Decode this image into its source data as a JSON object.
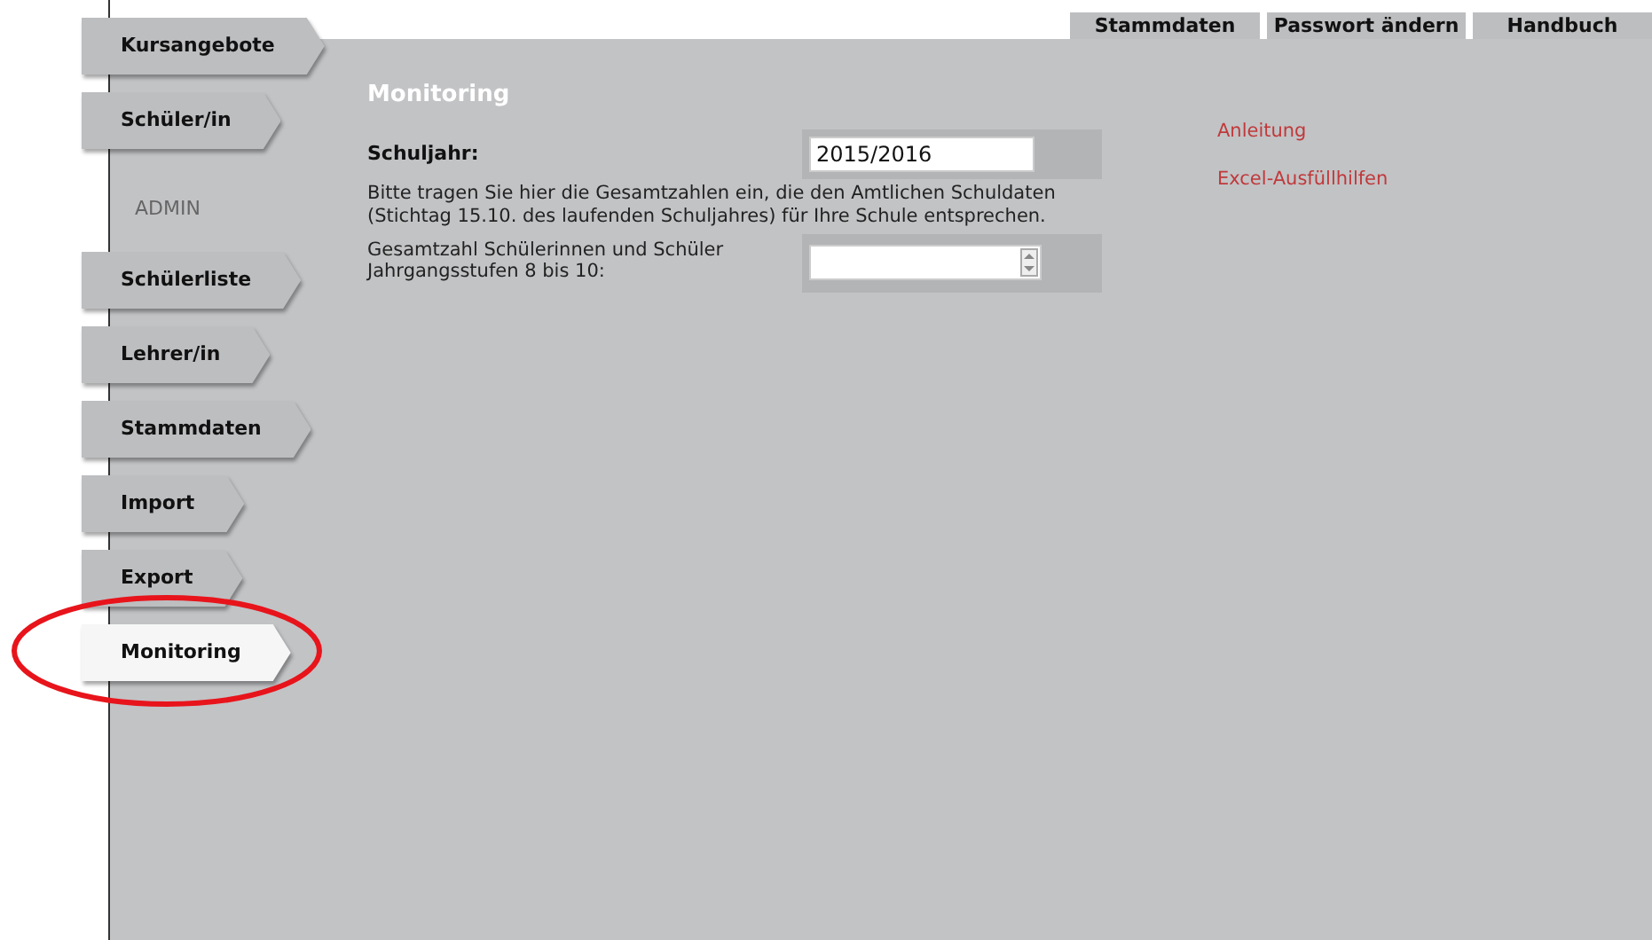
{
  "top_tabs": [
    {
      "label": "Stammdaten"
    },
    {
      "label": "Passwort ändern"
    },
    {
      "label": "Handbuch"
    }
  ],
  "sidebar": {
    "items": [
      {
        "kind": "tab",
        "label": "Kursangebote",
        "selected": false
      },
      {
        "kind": "tab",
        "label": "Schüler/in",
        "selected": false
      },
      {
        "kind": "heading",
        "label": "ADMIN"
      },
      {
        "kind": "tab",
        "label": "Schülerliste",
        "selected": false
      },
      {
        "kind": "tab",
        "label": "Lehrer/in",
        "selected": false
      },
      {
        "kind": "tab",
        "label": "Stammdaten",
        "selected": false
      },
      {
        "kind": "tab",
        "label": "Import",
        "selected": false
      },
      {
        "kind": "tab",
        "label": "Export",
        "selected": false
      },
      {
        "kind": "tab",
        "label": "Monitoring",
        "selected": true
      }
    ]
  },
  "page_title": "Monitoring",
  "school_year": {
    "label": "Schuljahr:",
    "value": "2015/2016"
  },
  "instructions": "Bitte tragen Sie hier die Gesamtzahlen ein, die den Amtlichen Schuldaten (Stichtag 15.10. des laufenden Schuljahres) für Ihre Schule entsprechen.",
  "student_total": {
    "label": "Gesamtzahl Schülerinnen und Schüler Jahrgangsstufen 8 bis 10:"
  },
  "links": [
    {
      "label": "Anleitung"
    },
    {
      "label": "Excel-Ausfüllhilfen"
    }
  ],
  "annotation": {
    "kind": "ellipse",
    "color": "#e8141b"
  }
}
